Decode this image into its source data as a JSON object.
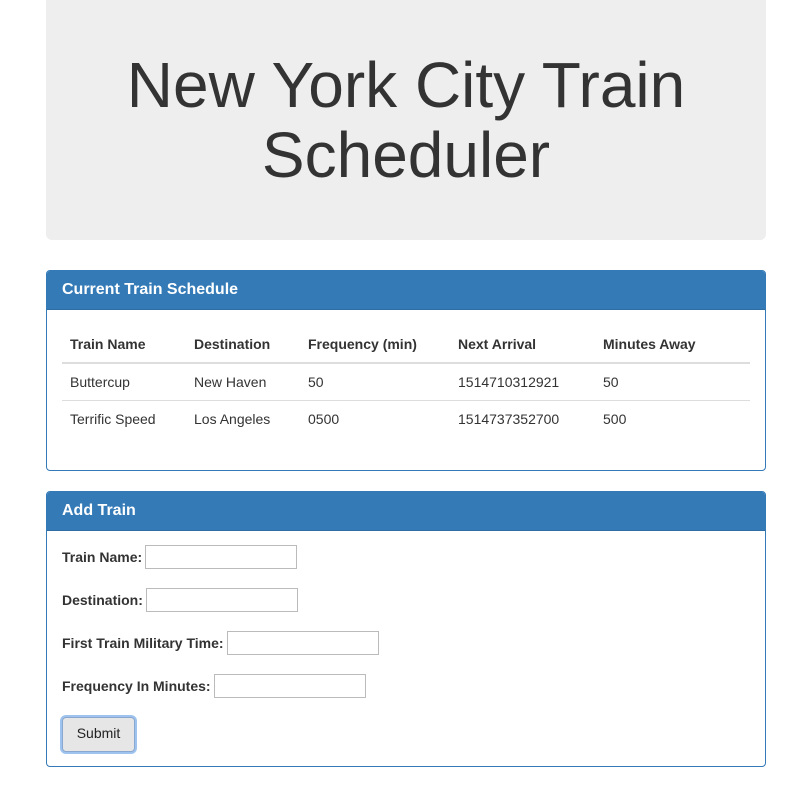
{
  "header": {
    "title": "New York City Train Scheduler"
  },
  "schedule": {
    "heading": "Current Train Schedule",
    "columns": [
      "Train Name",
      "Destination",
      "Frequency (min)",
      "Next Arrival",
      "Minutes Away"
    ],
    "rows": [
      [
        "Buttercup",
        "New Haven",
        "50",
        "1514710312921",
        "50"
      ],
      [
        "Terrific Speed",
        "Los Angeles",
        "0500",
        "1514737352700",
        "500"
      ]
    ]
  },
  "add_train": {
    "heading": "Add Train",
    "fields": [
      {
        "label": "Train Name:",
        "value": ""
      },
      {
        "label": "Destination:",
        "value": ""
      },
      {
        "label": "First Train Military Time:",
        "value": ""
      },
      {
        "label": "Frequency In Minutes:",
        "value": ""
      }
    ],
    "submit_label": "Submit"
  },
  "colors": {
    "panel_primary": "#337ab7",
    "jumbotron_bg": "#eeeeee"
  }
}
